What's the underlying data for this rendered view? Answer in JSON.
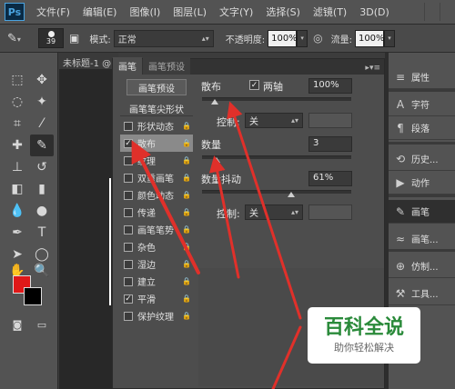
{
  "app": {
    "logo": "Ps"
  },
  "menu": [
    "文件(F)",
    "编辑(E)",
    "图像(I)",
    "图层(L)",
    "文字(Y)",
    "选择(S)",
    "滤镜(T)",
    "3D(D)"
  ],
  "options_bar": {
    "brush_size": "39",
    "mode_label": "模式:",
    "mode_value": "正常",
    "opacity_label": "不透明度:",
    "opacity_value": "100%",
    "flow_label": "流量:",
    "flow_value": "100%"
  },
  "document": {
    "tab_title": "未标题-1 @"
  },
  "brush_panel": {
    "tabs": [
      "画笔",
      "画笔预设"
    ],
    "preset_button": "画笔预设",
    "tip_shape_header": "画笔笔尖形状",
    "options": [
      {
        "label": "形状动态",
        "checked": false
      },
      {
        "label": "散布",
        "checked": true,
        "selected": true
      },
      {
        "label": "纹理",
        "checked": false
      },
      {
        "label": "双重画笔",
        "checked": false
      },
      {
        "label": "颜色动态",
        "checked": false
      },
      {
        "label": "传递",
        "checked": false
      },
      {
        "label": "画笔笔势",
        "checked": false
      },
      {
        "label": "杂色",
        "checked": false
      },
      {
        "label": "湿边",
        "checked": false
      },
      {
        "label": "建立",
        "checked": false
      },
      {
        "label": "平滑",
        "checked": true
      },
      {
        "label": "保护纹理",
        "checked": false
      }
    ],
    "scatter_label": "散布",
    "both_axes_label": "两轴",
    "both_axes_checked": true,
    "scatter_value": "100%",
    "control_label": "控制:",
    "control_value": "关",
    "count_label": "数量",
    "count_value": "3",
    "count_jitter_label": "数量抖动",
    "count_jitter_value": "61%",
    "control2_label": "控制:",
    "control2_value": "关"
  },
  "right_dock": [
    {
      "icon": "properties-icon",
      "label": "属性",
      "glyph": "≡"
    },
    {
      "icon": "character-icon",
      "label": "字符",
      "glyph": "A"
    },
    {
      "icon": "paragraph-icon",
      "label": "段落",
      "glyph": "¶"
    },
    {
      "icon": "history-icon",
      "label": "历史...",
      "glyph": "⟲"
    },
    {
      "icon": "actions-icon",
      "label": "动作",
      "glyph": "▶"
    },
    {
      "icon": "brush-icon",
      "label": "画笔",
      "glyph": "✎",
      "active": true
    },
    {
      "icon": "brush-presets-icon",
      "label": "画笔...",
      "glyph": "≈"
    },
    {
      "icon": "clone-source-icon",
      "label": "仿制...",
      "glyph": "⊕"
    },
    {
      "icon": "tool-presets-icon",
      "label": "工具...",
      "glyph": "⚒"
    }
  ],
  "watermark": {
    "title": "百科全说",
    "subtitle": "助你轻松解决"
  },
  "colors": {
    "foreground": "#e01818",
    "background": "#000000",
    "arrow": "#e0302a"
  }
}
